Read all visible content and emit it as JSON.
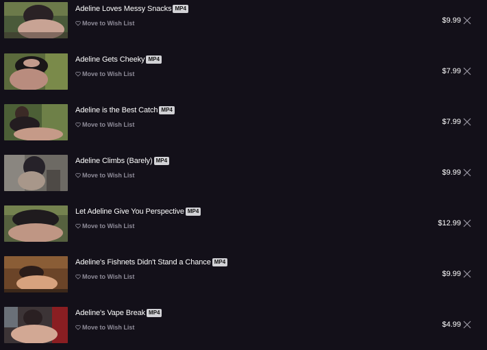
{
  "cart": {
    "items": [
      {
        "title": "Adeline Loves Messy Snacks",
        "format": "MP4",
        "wishlist_label": "Move to Wish List",
        "price": "$9.99",
        "thumb_colors": [
          "#4a5a3a",
          "#2a2225",
          "#c8a394"
        ],
        "remove_icon": "close-icon"
      },
      {
        "title": "Adeline Gets Cheeky",
        "format": "MP4",
        "wishlist_label": "Move to Wish List",
        "price": "$7.99",
        "thumb_colors": [
          "#5b6a3c",
          "#1a1618",
          "#b98c7e"
        ],
        "remove_icon": "close-icon"
      },
      {
        "title": "Adeline is the Best Catch",
        "format": "MP4",
        "wishlist_label": "Move to Wish List",
        "price": "$7.99",
        "thumb_colors": [
          "#4c5f36",
          "#231c20",
          "#c59a88"
        ],
        "remove_icon": "close-icon"
      },
      {
        "title": "Adeline Climbs (Barely)",
        "format": "MP4",
        "wishlist_label": "Move to Wish List",
        "price": "$9.99",
        "thumb_colors": [
          "#6d6a64",
          "#262229",
          "#a8978a"
        ],
        "remove_icon": "close-icon"
      },
      {
        "title": "Let Adeline Give You Perspective",
        "format": "MP4",
        "wishlist_label": "Move to Wish List",
        "price": "$12.99",
        "thumb_colors": [
          "#56613f",
          "#1f1b1e",
          "#bf9684"
        ],
        "remove_icon": "close-icon"
      },
      {
        "title": "Adeline's Fishnets Didn't Stand a Chance",
        "format": "MP4",
        "wishlist_label": "Move to Wish List",
        "price": "$9.99",
        "thumb_colors": [
          "#6b4428",
          "#2b1d1a",
          "#d7a27e"
        ],
        "remove_icon": "close-icon"
      },
      {
        "title": "Adeline's Vape Break",
        "format": "MP4",
        "wishlist_label": "Move to Wish List",
        "price": "$4.99",
        "thumb_colors": [
          "#3c3436",
          "#8a1e22",
          "#d2a894"
        ],
        "remove_icon": "close-icon"
      }
    ]
  },
  "icons": {
    "wishlist": "heart-outline-icon",
    "remove": "close-icon"
  },
  "colors": {
    "background": "#131019",
    "text": "#ffffff",
    "muted": "#8f8c99",
    "badge_bg": "#d2d2d6"
  }
}
